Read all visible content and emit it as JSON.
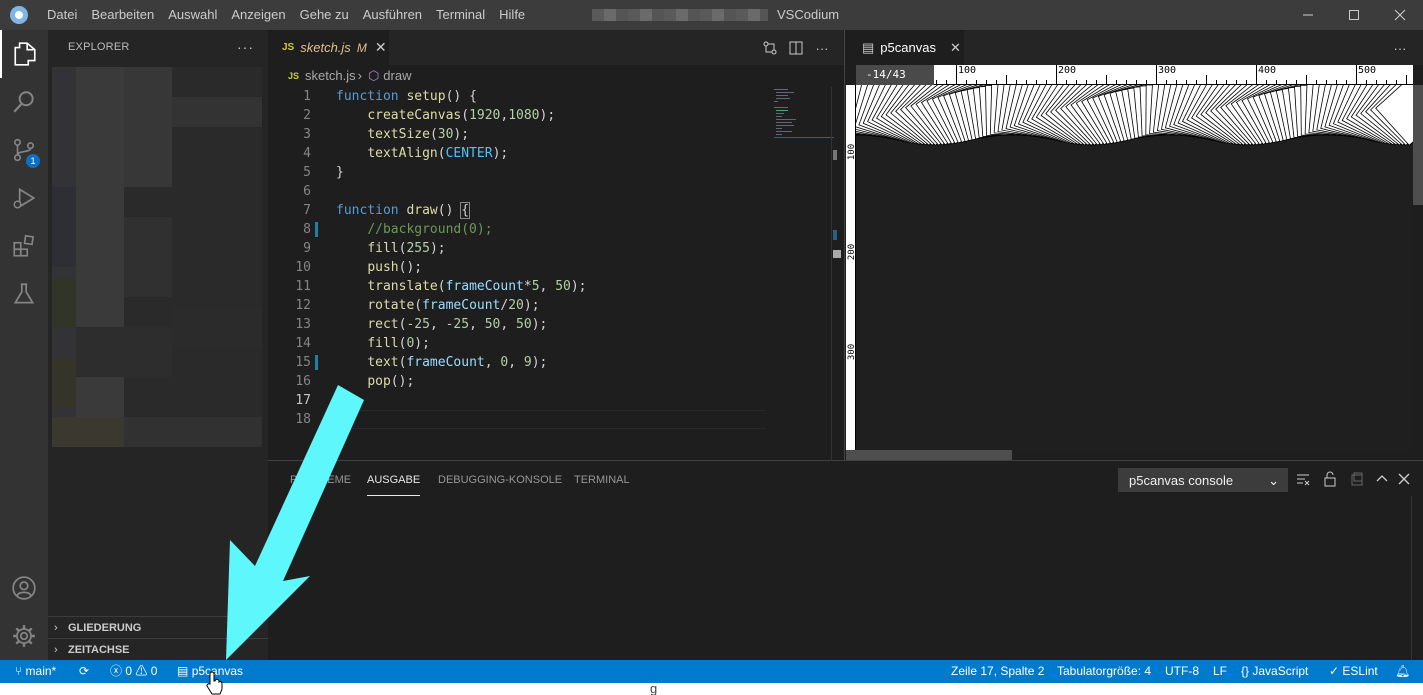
{
  "titlebar": {
    "menu": [
      "Datei",
      "Bearbeiten",
      "Auswahl",
      "Anzeigen",
      "Gehe zu",
      "Ausführen",
      "Terminal",
      "Hilfe"
    ],
    "app_title": "VSCodium"
  },
  "activity": {
    "items": [
      "explorer-icon",
      "search-icon",
      "source-control-icon",
      "run-debug-icon",
      "extensions-icon",
      "testing-icon",
      "accounts-icon",
      "manage-gear-icon"
    ],
    "scm_badge": "1"
  },
  "sidebar": {
    "title": "EXPLORER",
    "more": "···",
    "sections": [
      "GLIEDERUNG",
      "ZEITACHSE"
    ]
  },
  "editor": {
    "tab": {
      "name": "sketch.js",
      "status": "M",
      "icon": "JS"
    },
    "breadcrumb": {
      "file": "sketch.js",
      "symbol": "draw"
    },
    "current_line": 17,
    "lines": [
      {
        "n": "1"
      },
      {
        "n": "2"
      },
      {
        "n": "3"
      },
      {
        "n": "4"
      },
      {
        "n": "5"
      },
      {
        "n": "6"
      },
      {
        "n": "7"
      },
      {
        "n": "8"
      },
      {
        "n": "9"
      },
      {
        "n": "10"
      },
      {
        "n": "11"
      },
      {
        "n": "12"
      },
      {
        "n": "13"
      },
      {
        "n": "14"
      },
      {
        "n": "15"
      },
      {
        "n": "16"
      },
      {
        "n": "17"
      },
      {
        "n": "18"
      }
    ]
  },
  "p5": {
    "tab": "p5canvas",
    "coords": "-14/43",
    "ruler_top": [
      "100",
      "200",
      "300",
      "400",
      "500"
    ],
    "ruler_left": [
      "100",
      "200",
      "300"
    ]
  },
  "panel": {
    "tabs": [
      "PROBLEME",
      "AUSGABE",
      "DEBUGGING-KONSOLE",
      "TERMINAL"
    ],
    "active_tab": "AUSGABE",
    "output_channel": "p5canvas console"
  },
  "statusbar": {
    "branch": "main*",
    "errors": "0",
    "warnings": "0",
    "p5canvas": "p5canvas",
    "position": "Zeile 17, Spalte 2",
    "tab_size": "Tabulatorgröße: 4",
    "encoding": "UTF-8",
    "eol": "LF",
    "language": "JavaScript",
    "linter": "ESLint"
  },
  "colors": {
    "accent": "#007acc",
    "arrow": "#5ef7fc",
    "modified": "#e2c08d"
  }
}
